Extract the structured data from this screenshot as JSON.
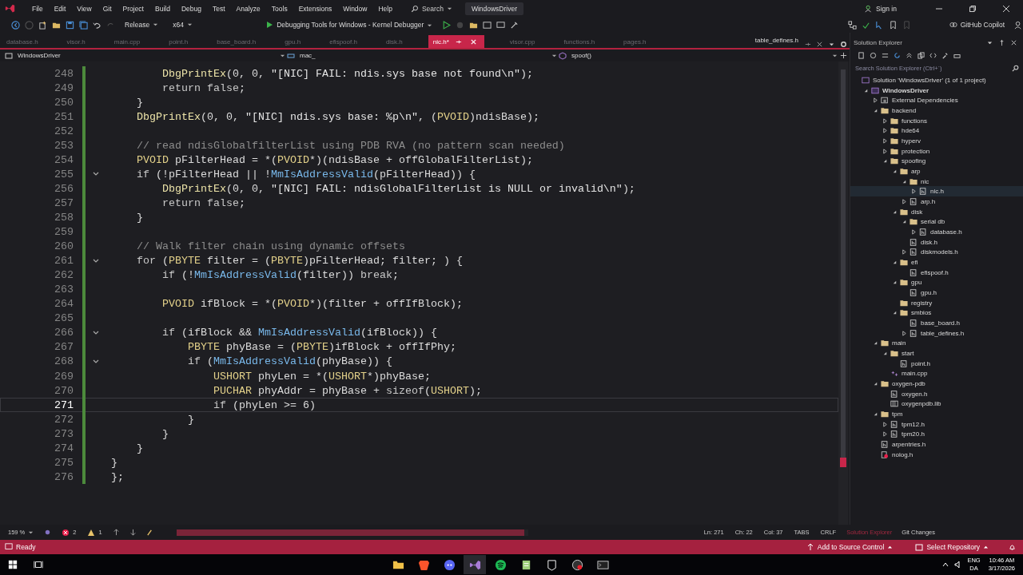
{
  "menu": {
    "items": [
      "File",
      "Edit",
      "View",
      "Git",
      "Project",
      "Build",
      "Debug",
      "Test",
      "Analyze",
      "Tools",
      "Extensions",
      "Window",
      "Help"
    ],
    "search": "Search",
    "solution_name": "WindowsDriver",
    "sign_in": "Sign in"
  },
  "toolbar": {
    "configuration": "Release",
    "platform": "x64",
    "debugger": "Debugging Tools for Windows - Kernel Debugger",
    "copilot": "GitHub Copilot"
  },
  "tabs": [
    {
      "label": "database.h",
      "selected": false
    },
    {
      "label": "visor.h",
      "selected": false
    },
    {
      "label": "main.cpp",
      "selected": false
    },
    {
      "label": "point.h",
      "selected": false
    },
    {
      "label": "base_board.h",
      "selected": false
    },
    {
      "label": "gpu.h",
      "selected": false
    },
    {
      "label": "efispoof.h",
      "selected": false
    },
    {
      "label": "disk.h",
      "selected": false
    },
    {
      "label": "nic.h*",
      "selected": true
    },
    {
      "label": "visor.cpp",
      "selected": false
    },
    {
      "label": "functions.h",
      "selected": false
    },
    {
      "label": "pages.h",
      "selected": false
    }
  ],
  "right_tab": {
    "label": "table_defines.h"
  },
  "navigation": {
    "project": "WindowsDriver",
    "scope": "mac_",
    "member": "spoof()"
  },
  "code_lines": [
    {
      "number": "248",
      "fold": false,
      "current": false,
      "tokens": [
        {
          "kind": "fn",
          "text": "        DbgPrintEx"
        },
        {
          "kind": "txt",
          "text": "(0, 0, "
        },
        {
          "kind": "str",
          "text": "\"[NIC] FAIL: ndis.sys base not found\\n\""
        },
        {
          "kind": "txt",
          "text": ");"
        }
      ]
    },
    {
      "number": "249",
      "fold": false,
      "current": false,
      "tokens": [
        {
          "kind": "kw",
          "text": "        return false"
        },
        {
          "kind": "txt",
          "text": ";"
        }
      ]
    },
    {
      "number": "250",
      "fold": false,
      "current": false,
      "tokens": [
        {
          "kind": "txt",
          "text": "    }"
        }
      ]
    },
    {
      "number": "251",
      "fold": false,
      "current": false,
      "tokens": [
        {
          "kind": "fn",
          "text": "    DbgPrintEx"
        },
        {
          "kind": "txt",
          "text": "(0, 0, "
        },
        {
          "kind": "str",
          "text": "\"[NIC] ndis.sys base: %p\\n\""
        },
        {
          "kind": "txt",
          "text": ", ("
        },
        {
          "kind": "type",
          "text": "PVOID"
        },
        {
          "kind": "txt",
          "text": ")ndisBase);"
        }
      ]
    },
    {
      "number": "252",
      "fold": false,
      "current": false
    },
    {
      "number": "253",
      "fold": false,
      "current": false,
      "tokens": [
        {
          "kind": "cmt",
          "text": "    // read ndisGlobalfilterList using PDB RVA (no pattern scan needed)"
        }
      ]
    },
    {
      "number": "254",
      "fold": false,
      "current": false,
      "tokens": [
        {
          "kind": "type",
          "text": "    PVOID"
        },
        {
          "kind": "txt",
          "text": " pFilterHead = *("
        },
        {
          "kind": "type",
          "text": "PVOID"
        },
        {
          "kind": "txt",
          "text": "*)(ndisBase + offGlobalFilterList);"
        }
      ]
    },
    {
      "number": "255",
      "fold": true,
      "current": false,
      "tokens": [
        {
          "kind": "kw",
          "text": "    if"
        },
        {
          "kind": "txt",
          "text": " (!pFilterHead || !"
        },
        {
          "kind": "api",
          "text": "MmIsAddressValid"
        },
        {
          "kind": "txt",
          "text": "(pFilterHead)) {"
        }
      ]
    },
    {
      "number": "256",
      "fold": false,
      "current": false,
      "tokens": [
        {
          "kind": "fn",
          "text": "        DbgPrintEx"
        },
        {
          "kind": "txt",
          "text": "(0, 0, "
        },
        {
          "kind": "str",
          "text": "\"[NIC] FAIL: ndisGlobalFilterList is NULL or invalid\\n\""
        },
        {
          "kind": "txt",
          "text": ");"
        }
      ]
    },
    {
      "number": "257",
      "fold": false,
      "current": false,
      "tokens": [
        {
          "kind": "kw",
          "text": "        return false"
        },
        {
          "kind": "txt",
          "text": ";"
        }
      ]
    },
    {
      "number": "258",
      "fold": false,
      "current": false,
      "tokens": [
        {
          "kind": "txt",
          "text": "    }"
        }
      ]
    },
    {
      "number": "259",
      "fold": false,
      "current": false
    },
    {
      "number": "260",
      "fold": false,
      "current": false,
      "tokens": [
        {
          "kind": "cmt",
          "text": "    // Walk filter chain using dynamic offsets"
        }
      ]
    },
    {
      "number": "261",
      "fold": true,
      "current": false,
      "tokens": [
        {
          "kind": "kw",
          "text": "    for"
        },
        {
          "kind": "txt",
          "text": " ("
        },
        {
          "kind": "type",
          "text": "PBYTE"
        },
        {
          "kind": "txt",
          "text": " filter = ("
        },
        {
          "kind": "type",
          "text": "PBYTE"
        },
        {
          "kind": "txt",
          "text": ")pFilterHead; filter; ) {"
        }
      ]
    },
    {
      "number": "262",
      "fold": false,
      "current": false,
      "tokens": [
        {
          "kind": "kw",
          "text": "        if"
        },
        {
          "kind": "txt",
          "text": " (!"
        },
        {
          "kind": "api",
          "text": "MmIsAddressValid"
        },
        {
          "kind": "txt",
          "text": "(filter)) "
        },
        {
          "kind": "kw",
          "text": "break"
        },
        {
          "kind": "txt",
          "text": ";"
        }
      ]
    },
    {
      "number": "263",
      "fold": false,
      "current": false
    },
    {
      "number": "264",
      "fold": false,
      "current": false,
      "tokens": [
        {
          "kind": "type",
          "text": "        PVOID"
        },
        {
          "kind": "txt",
          "text": " ifBlock = *("
        },
        {
          "kind": "type",
          "text": "PVOID"
        },
        {
          "kind": "txt",
          "text": "*)(filter + offIfBlock);"
        }
      ]
    },
    {
      "number": "265",
      "fold": false,
      "current": false
    },
    {
      "number": "266",
      "fold": true,
      "current": false,
      "tokens": [
        {
          "kind": "kw",
          "text": "        if"
        },
        {
          "kind": "txt",
          "text": " (ifBlock && "
        },
        {
          "kind": "api",
          "text": "MmIsAddressValid"
        },
        {
          "kind": "txt",
          "text": "(ifBlock)) {"
        }
      ]
    },
    {
      "number": "267",
      "fold": false,
      "current": false,
      "tokens": [
        {
          "kind": "type",
          "text": "            PBYTE"
        },
        {
          "kind": "txt",
          "text": " phyBase = ("
        },
        {
          "kind": "type",
          "text": "PBYTE"
        },
        {
          "kind": "txt",
          "text": ")ifBlock + offIfPhy;"
        }
      ]
    },
    {
      "number": "268",
      "fold": true,
      "current": false,
      "tokens": [
        {
          "kind": "kw",
          "text": "            if"
        },
        {
          "kind": "txt",
          "text": " ("
        },
        {
          "kind": "api",
          "text": "MmIsAddressValid"
        },
        {
          "kind": "txt",
          "text": "(phyBase)) {"
        }
      ]
    },
    {
      "number": "269",
      "fold": false,
      "current": false,
      "tokens": [
        {
          "kind": "type",
          "text": "                USHORT"
        },
        {
          "kind": "txt",
          "text": " phyLen = *("
        },
        {
          "kind": "type",
          "text": "USHORT"
        },
        {
          "kind": "txt",
          "text": "*)phyBase;"
        }
      ]
    },
    {
      "number": "270",
      "fold": false,
      "current": false,
      "tokens": [
        {
          "kind": "type",
          "text": "                PUCHAR"
        },
        {
          "kind": "txt",
          "text": " phyAddr = phyBase + "
        },
        {
          "kind": "kw",
          "text": "sizeof"
        },
        {
          "kind": "txt",
          "text": "("
        },
        {
          "kind": "type",
          "text": "USHORT"
        },
        {
          "kind": "txt",
          "text": ");"
        }
      ]
    },
    {
      "number": "271",
      "fold": false,
      "current": true,
      "tokens": [
        {
          "kind": "kw",
          "text": "                if"
        },
        {
          "kind": "txt",
          "text": " (phyLen >= 6)"
        }
      ]
    },
    {
      "number": "272",
      "fold": false,
      "current": false,
      "tokens": [
        {
          "kind": "txt",
          "text": "            }"
        }
      ]
    },
    {
      "number": "273",
      "fold": false,
      "current": false,
      "tokens": [
        {
          "kind": "txt",
          "text": "        }"
        }
      ]
    },
    {
      "number": "274",
      "fold": false,
      "current": false,
      "tokens": [
        {
          "kind": "txt",
          "text": "    }"
        }
      ]
    },
    {
      "number": "275",
      "fold": false,
      "current": false,
      "tokens": [
        {
          "kind": "txt",
          "text": "}"
        }
      ]
    },
    {
      "number": "276",
      "fold": false,
      "current": false,
      "tokens": [
        {
          "kind": "txt",
          "text": "};"
        }
      ]
    }
  ],
  "solution_explorer": {
    "title": "Solution Explorer",
    "search_placeholder": "Search Solution Explorer (Ctrl+`)",
    "tree": [
      {
        "label": "Solution 'WindowsDriver' (1 of 1 project)",
        "kind": "solution",
        "selected": false,
        "children": [
          {
            "label": "WindowsDriver",
            "kind": "project",
            "expanded": true,
            "selected": false,
            "children": [
              {
                "label": "External Dependencies",
                "kind": "external",
                "expanded": false,
                "selected": false
              },
              {
                "label": "backend",
                "kind": "folder",
                "expanded": true,
                "selected": false,
                "children": [
                  {
                    "label": "functions",
                    "kind": "folder",
                    "expanded": false,
                    "selected": false
                  },
                  {
                    "label": "hde64",
                    "kind": "folder",
                    "expanded": false,
                    "selected": false
                  },
                  {
                    "label": "hyperv",
                    "kind": "folder",
                    "expanded": false,
                    "selected": false
                  },
                  {
                    "label": "protection",
                    "kind": "folder",
                    "expanded": false,
                    "selected": false
                  },
                  {
                    "label": "spoofing",
                    "kind": "folder",
                    "expanded": true,
                    "selected": false,
                    "children": [
                      {
                        "label": "arp",
                        "kind": "folder",
                        "expanded": true,
                        "selected": false,
                        "children": [
                          {
                            "label": "nic",
                            "kind": "folder",
                            "expanded": true,
                            "selected": false,
                            "children": [
                              {
                                "label": "nic.h",
                                "kind": "header",
                                "expanded": false,
                                "selected": true
                              }
                            ]
                          },
                          {
                            "label": "arp.h",
                            "kind": "header",
                            "expanded": false,
                            "selected": false
                          }
                        ]
                      },
                      {
                        "label": "disk",
                        "kind": "folder",
                        "expanded": true,
                        "selected": false,
                        "children": [
                          {
                            "label": "serial db",
                            "kind": "folder",
                            "expanded": true,
                            "selected": false,
                            "children": [
                              {
                                "label": "database.h",
                                "kind": "header",
                                "expanded": false,
                                "selected": false
                              }
                            ]
                          },
                          {
                            "label": "disk.h",
                            "kind": "header",
                            "selected": false
                          },
                          {
                            "label": "diskmodels.h",
                            "kind": "header",
                            "expanded": false,
                            "selected": false
                          }
                        ]
                      },
                      {
                        "label": "efi",
                        "kind": "folder",
                        "expanded": true,
                        "selected": false,
                        "children": [
                          {
                            "label": "efispoof.h",
                            "kind": "header",
                            "selected": false
                          }
                        ]
                      },
                      {
                        "label": "gpu",
                        "kind": "folder",
                        "expanded": true,
                        "selected": false,
                        "children": [
                          {
                            "label": "gpu.h",
                            "kind": "header",
                            "selected": false
                          }
                        ]
                      },
                      {
                        "label": "registry",
                        "kind": "folder",
                        "selected": false
                      },
                      {
                        "label": "smbios",
                        "kind": "folder",
                        "expanded": true,
                        "selected": false,
                        "children": [
                          {
                            "label": "base_board.h",
                            "kind": "header",
                            "selected": false
                          },
                          {
                            "label": "table_defines.h",
                            "kind": "header",
                            "expanded": false,
                            "selected": false
                          }
                        ]
                      }
                    ]
                  }
                ]
              },
              {
                "label": "main",
                "kind": "folder",
                "expanded": true,
                "selected": false,
                "children": [
                  {
                    "label": "start",
                    "kind": "folder",
                    "expanded": true,
                    "selected": false,
                    "children": [
                      {
                        "label": "point.h",
                        "kind": "header",
                        "selected": false
                      }
                    ]
                  },
                  {
                    "label": "main.cpp",
                    "kind": "cpp",
                    "selected": false
                  }
                ]
              },
              {
                "label": "oxygen-pdb",
                "kind": "folder",
                "expanded": true,
                "selected": false,
                "children": [
                  {
                    "label": "oxygen.h",
                    "kind": "header",
                    "selected": false
                  },
                  {
                    "label": "oxygenpdb.lib",
                    "kind": "lib",
                    "selected": false
                  }
                ]
              },
              {
                "label": "tpm",
                "kind": "folder",
                "expanded": true,
                "selected": false,
                "children": [
                  {
                    "label": "tpm12.h",
                    "kind": "header",
                    "expanded": false,
                    "selected": false
                  },
                  {
                    "label": "tpm20.h",
                    "kind": "header",
                    "expanded": false,
                    "selected": false
                  }
                ]
              },
              {
                "label": "arpentries.h",
                "kind": "header",
                "selected": false
              },
              {
                "label": "nolog.h",
                "kind": "header-error",
                "selected": false
              }
            ]
          }
        ]
      }
    ]
  },
  "editor_status": {
    "zoom": "159 %",
    "errors": "2",
    "warnings": "1",
    "line": "Ln: 271",
    "char": "Ch: 22",
    "col": "Col: 37",
    "indent": "TABS",
    "line_ending": "CRLF"
  },
  "panel_tabs": [
    {
      "label": "Solution Explorer",
      "selected": true
    },
    {
      "label": "Git Changes",
      "selected": false
    }
  ],
  "status_bar": {
    "state": "Ready",
    "source_control": "Add to Source Control",
    "repository": "Select Repository"
  },
  "taskbar": {
    "apps": [
      {
        "kind": "folder",
        "selected": false
      },
      {
        "kind": "brave",
        "selected": false
      },
      {
        "kind": "discord",
        "selected": false
      },
      {
        "kind": "visual-studio",
        "selected": true
      },
      {
        "kind": "spotify",
        "selected": false
      },
      {
        "kind": "notepad",
        "selected": false
      },
      {
        "kind": "epic",
        "selected": false
      },
      {
        "kind": "obs",
        "selected": false
      },
      {
        "kind": "terminal",
        "selected": false
      }
    ],
    "language": "ENG",
    "layout": "DA",
    "time": "10:46 AM",
    "date": "3/17/2026"
  }
}
